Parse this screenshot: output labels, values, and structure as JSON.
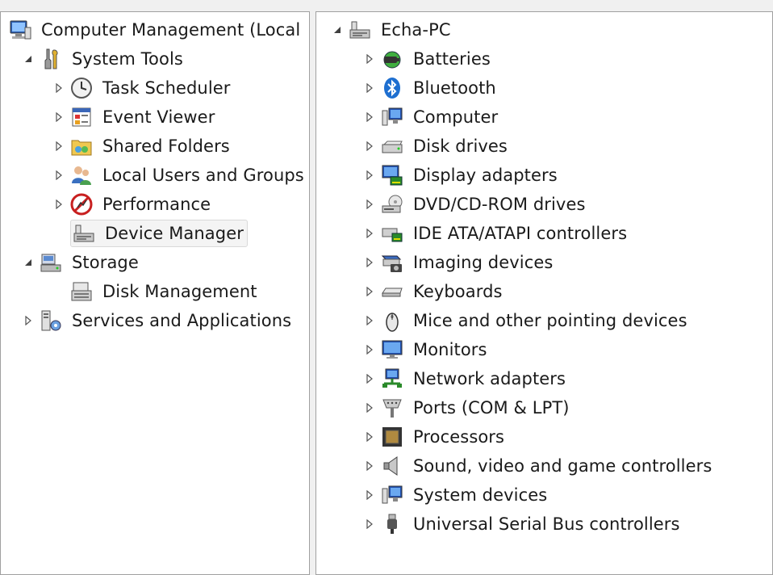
{
  "left_tree": {
    "root": {
      "label": "Computer Management (Local",
      "icon": "computer-management-icon"
    },
    "system_tools": {
      "label": "System Tools",
      "icon": "tools-icon",
      "children": [
        {
          "label": "Task Scheduler",
          "icon": "clock-icon"
        },
        {
          "label": "Event Viewer",
          "icon": "event-viewer-icon"
        },
        {
          "label": "Shared Folders",
          "icon": "shared-folder-icon"
        },
        {
          "label": "Local Users and Groups",
          "icon": "users-icon"
        },
        {
          "label": "Performance",
          "icon": "performance-icon"
        },
        {
          "label": "Device Manager",
          "icon": "device-manager-icon",
          "selected": true
        }
      ]
    },
    "storage": {
      "label": "Storage",
      "icon": "storage-icon",
      "children": [
        {
          "label": "Disk Management",
          "icon": "disk-management-icon"
        }
      ]
    },
    "services": {
      "label": "Services and Applications",
      "icon": "services-icon"
    }
  },
  "right_tree": {
    "root": {
      "label": "Echa-PC",
      "icon": "computer-root-icon"
    },
    "categories": [
      {
        "label": "Batteries",
        "icon": "battery-icon"
      },
      {
        "label": "Bluetooth",
        "icon": "bluetooth-icon"
      },
      {
        "label": "Computer",
        "icon": "computer-icon"
      },
      {
        "label": "Disk drives",
        "icon": "disk-drive-icon"
      },
      {
        "label": "Display adapters",
        "icon": "display-adapter-icon"
      },
      {
        "label": "DVD/CD-ROM drives",
        "icon": "dvd-drive-icon"
      },
      {
        "label": "IDE ATA/ATAPI controllers",
        "icon": "ide-controller-icon"
      },
      {
        "label": "Imaging devices",
        "icon": "camera-icon"
      },
      {
        "label": "Keyboards",
        "icon": "keyboard-icon"
      },
      {
        "label": "Mice and other pointing devices",
        "icon": "mouse-icon"
      },
      {
        "label": "Monitors",
        "icon": "monitor-icon"
      },
      {
        "label": "Network adapters",
        "icon": "network-icon"
      },
      {
        "label": "Ports (COM & LPT)",
        "icon": "port-icon"
      },
      {
        "label": "Processors",
        "icon": "processor-icon"
      },
      {
        "label": "Sound, video and game controllers",
        "icon": "speaker-icon"
      },
      {
        "label": "System devices",
        "icon": "system-devices-icon"
      },
      {
        "label": "Universal Serial Bus controllers",
        "icon": "usb-icon"
      }
    ]
  }
}
